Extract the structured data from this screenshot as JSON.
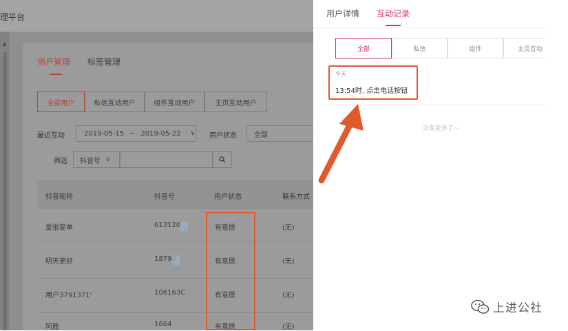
{
  "platform_title": "理平台",
  "left": {
    "tabs": [
      "用户管理",
      "标签管理"
    ],
    "segments": [
      "全部用户",
      "私信互动用户",
      "组件互动用户",
      "主页互动用户"
    ],
    "recent_label": "最近互动",
    "date_start": "2019-05-15",
    "date_sep": "~",
    "date_end": "2019-05-22",
    "status_label": "用户状态",
    "status_value": "全部",
    "filter_label": "筛选",
    "filter_select": "抖音号",
    "columns": [
      "抖音昵称",
      "抖音号",
      "用户状态",
      "联系方式"
    ],
    "rows": [
      {
        "nickname": "爱很简单",
        "id": "613120",
        "status": "有意愿",
        "contact": "(无)"
      },
      {
        "nickname": "明天更好",
        "id": "18790",
        "status": "有意愿",
        "contact": "(无)"
      },
      {
        "nickname": "用户3791371'",
        "id": "106163C",
        "status": "有意愿",
        "contact": "(无)"
      },
      {
        "nickname": "阿胜",
        "id": "1664",
        "status": "有意愿",
        "contact": "(无)"
      }
    ]
  },
  "right": {
    "tabs": [
      "用户详情",
      "互动记录"
    ],
    "filters": [
      "全部",
      "私信",
      "组件",
      "主页互动"
    ],
    "today": "今天",
    "record": "13:54时, 点击电话按钮",
    "no_more": "没有更多了~"
  },
  "watermark": "上进公社",
  "icons": {
    "search": "search-icon",
    "chevron": "chevron-down-icon",
    "arrow": "pointer-arrow-icon",
    "wechat": "wechat-icon"
  },
  "colors": {
    "accent": "#d62f5a",
    "highlight": "#e05a2b",
    "dim_accent": "#b8453b"
  }
}
